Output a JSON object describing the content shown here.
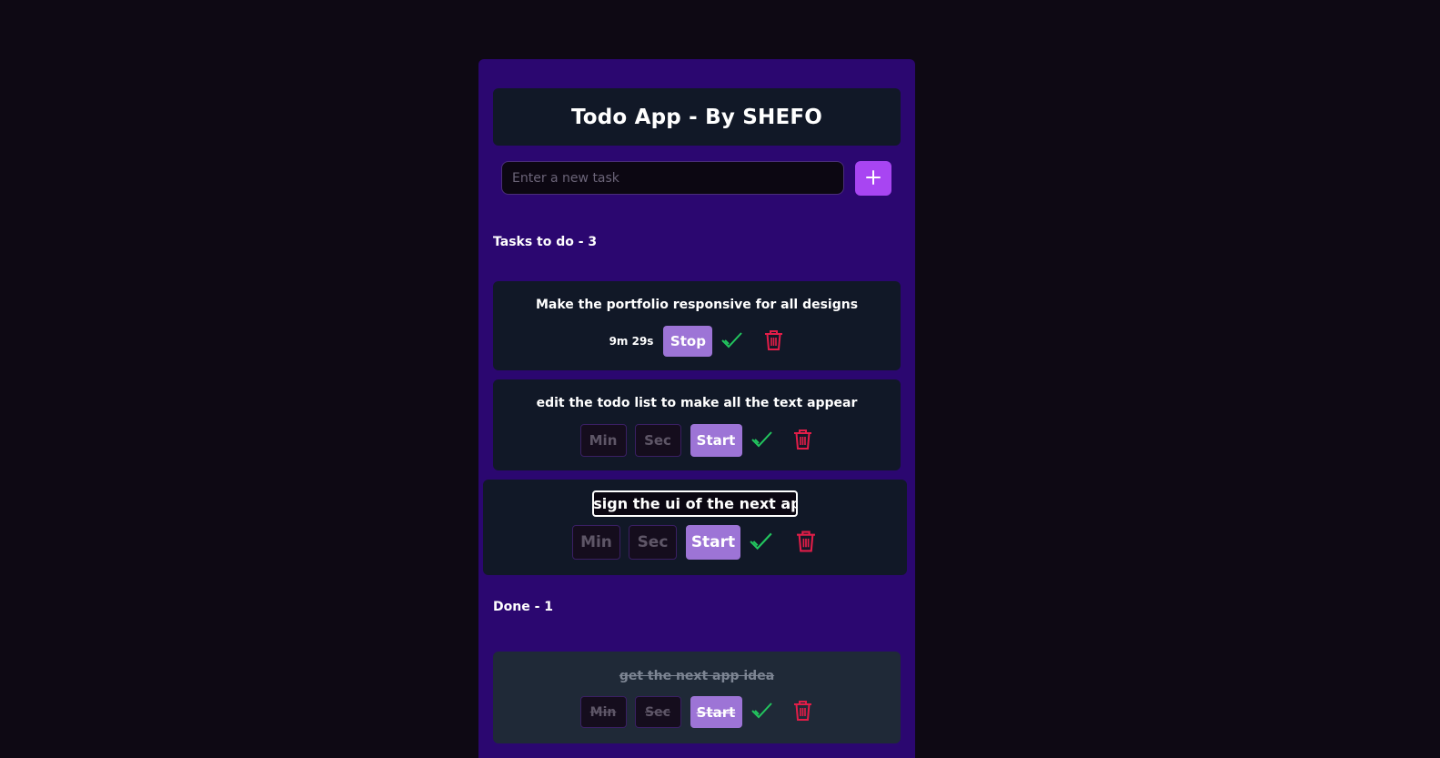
{
  "app": {
    "title": "Todo App - By SHEFO"
  },
  "new_task": {
    "placeholder": "Enter a new task",
    "value": "",
    "add_icon": "plus-icon"
  },
  "todo_section": {
    "heading": "Tasks to do - 3",
    "tasks": [
      {
        "title": "Make the portfolio responsive for all designs",
        "timer": "9m 29s",
        "action_label": "Stop",
        "complete_icon": "check-icon",
        "delete_icon": "trash-icon"
      },
      {
        "title": "edit the todo list to make all the text appear",
        "min_placeholder": "Min",
        "sec_placeholder": "Sec",
        "action_label": "Start",
        "complete_icon": "check-icon",
        "delete_icon": "trash-icon"
      },
      {
        "title_editing": "lesign the ui of the next app",
        "min_placeholder": "Min",
        "sec_placeholder": "Sec",
        "action_label": "Start",
        "complete_icon": "check-icon",
        "delete_icon": "trash-icon"
      }
    ]
  },
  "done_section": {
    "heading": "Done - 1",
    "tasks": [
      {
        "title": "get the next app idea",
        "min_placeholder": "Min",
        "sec_placeholder": "Sec",
        "action_label": "Start",
        "complete_icon": "check-icon",
        "delete_icon": "trash-icon"
      }
    ]
  },
  "colors": {
    "background": "#0e0914",
    "panel": "#2b0770",
    "card": "#111827",
    "done_card": "#1f2937",
    "accent": "#a845f2",
    "button": "#9d74d6",
    "check": "#22c55e",
    "delete": "#e11d48"
  }
}
